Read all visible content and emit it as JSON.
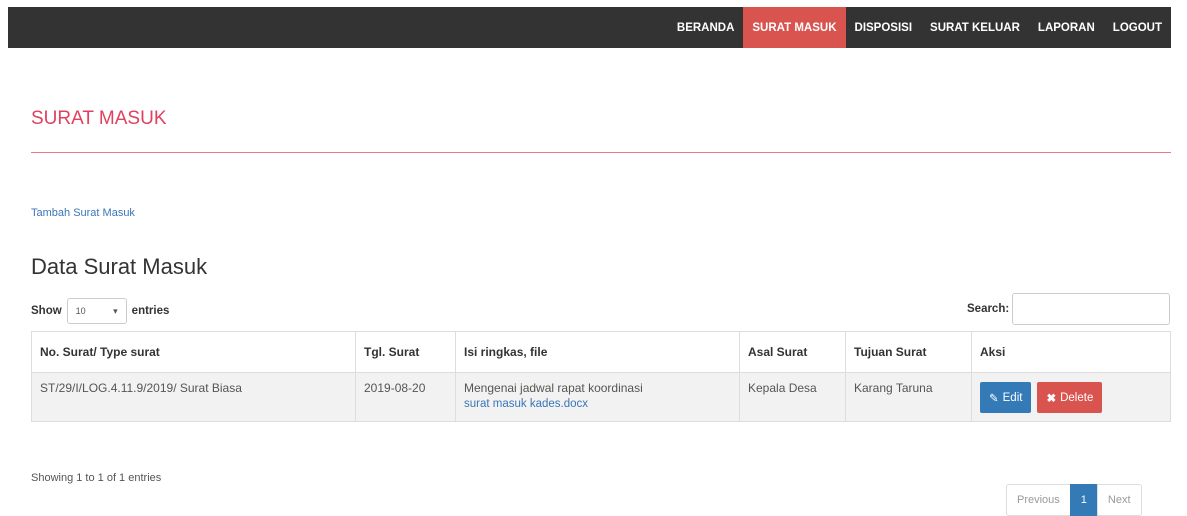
{
  "nav": {
    "items": [
      "BERANDA",
      "SURAT MASUK",
      "DISPOSISI",
      "SURAT KELUAR",
      "LAPORAN",
      "LOGOUT"
    ],
    "active_index": 1
  },
  "page": {
    "title": "SURAT MASUK",
    "add_link": "Tambah Surat Masuk",
    "data_title": "Data Surat Masuk"
  },
  "table_controls": {
    "show_label": "Show",
    "entries_value": "10",
    "entries_label": "entries",
    "search_label": "Search:"
  },
  "table": {
    "headers": [
      "No. Surat/ Type surat",
      "Tgl. Surat",
      "Isi ringkas, file",
      "Asal Surat",
      "Tujuan Surat",
      "Aksi"
    ],
    "rows": [
      {
        "no_surat": "ST/29/I/LOG.4.11.9/2019/ Surat Biasa",
        "tgl": "2019-08-20",
        "isi": "Mengenai jadwal rapat koordinasi",
        "file": "surat masuk kades.docx",
        "asal": "Kepala Desa",
        "tujuan": "Karang Taruna",
        "edit_label": "Edit",
        "delete_label": "Delete"
      }
    ]
  },
  "footer": {
    "showing": "Showing 1 to 1 of 1 entries",
    "previous": "Previous",
    "page": "1",
    "next": "Next"
  },
  "colors": {
    "navbar": "#333333",
    "active_nav": "#d9534f",
    "title": "#e0415e",
    "edit_button": "#337ab7",
    "delete_button": "#d9534f"
  }
}
